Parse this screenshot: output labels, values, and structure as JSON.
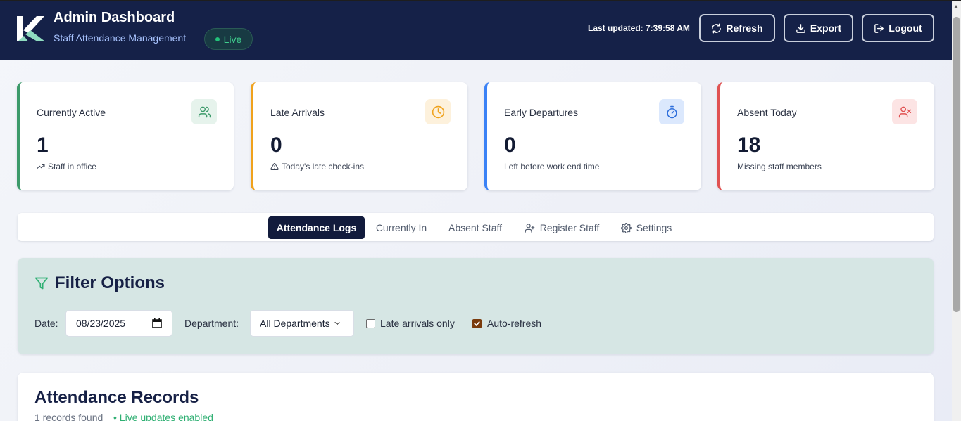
{
  "header": {
    "title": "Admin Dashboard",
    "subtitle": "Staff Attendance Management",
    "live_label": "Live",
    "last_updated": "Last updated: 7:39:58 AM",
    "buttons": {
      "refresh": "Refresh",
      "export": "Export",
      "logout": "Logout"
    }
  },
  "stats": [
    {
      "label": "Currently Active",
      "value": "1",
      "sub": "Staff in office",
      "icon": "users-icon",
      "color": "#3c9a6a"
    },
    {
      "label": "Late Arrivals",
      "value": "0",
      "sub": "Today's late check-ins",
      "icon": "clock-icon",
      "color": "#f0a21c"
    },
    {
      "label": "Early Departures",
      "value": "0",
      "sub": "Left before work end time",
      "icon": "timer-icon",
      "color": "#3b82f6"
    },
    {
      "label": "Absent Today",
      "value": "18",
      "sub": "Missing staff members",
      "icon": "user-x-icon",
      "color": "#e05252"
    }
  ],
  "tabs": [
    {
      "label": "Attendance Logs",
      "active": true
    },
    {
      "label": "Currently In",
      "active": false
    },
    {
      "label": "Absent Staff",
      "active": false
    },
    {
      "label": "Register Staff",
      "active": false,
      "icon": "user-plus-icon"
    },
    {
      "label": "Settings",
      "active": false,
      "icon": "gear-icon"
    }
  ],
  "filter": {
    "title": "Filter Options",
    "date_label": "Date:",
    "date_value": "08/23/2025",
    "department_label": "Department:",
    "department_value": "All Departments",
    "late_only_label": "Late arrivals only",
    "late_only_checked": false,
    "auto_refresh_label": "Auto-refresh",
    "auto_refresh_checked": true
  },
  "records": {
    "title": "Attendance Records",
    "count": "1 records found",
    "live_text": "• Live updates enabled"
  },
  "colors": {
    "header_bg": "#152148",
    "accent_dark": "#121b3c",
    "filter_bg": "#d6e6e4",
    "live_green": "#3fcf8e"
  }
}
